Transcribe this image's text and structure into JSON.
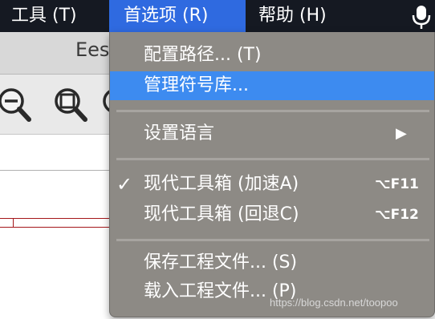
{
  "menubar": {
    "tools": "工具 (T)",
    "prefs": "首选项 (R)",
    "help": "帮助 (H)",
    "active_color": "#2f6ae0",
    "bar_color": "#151922"
  },
  "window": {
    "title": "Ees"
  },
  "dropdown": {
    "items": [
      {
        "label": "配置路径... (T)"
      },
      {
        "label": "管理符号库...",
        "highlighted": true
      },
      {
        "label": "设置语言",
        "has_submenu": true
      },
      {
        "label": "现代工具箱 (加速A)",
        "checked": true,
        "shortcut": "⌥F11"
      },
      {
        "label": "现代工具箱 (回退C)",
        "shortcut": "⌥F12"
      },
      {
        "label": "保存工程文件... (S)"
      },
      {
        "label": "载入工程文件... (P)"
      }
    ],
    "checkmark": "✓",
    "submenu_arrow": "▶",
    "highlight_color": "#3d8bf0"
  },
  "watermark": "https://blog.csdn.net/toopoo"
}
